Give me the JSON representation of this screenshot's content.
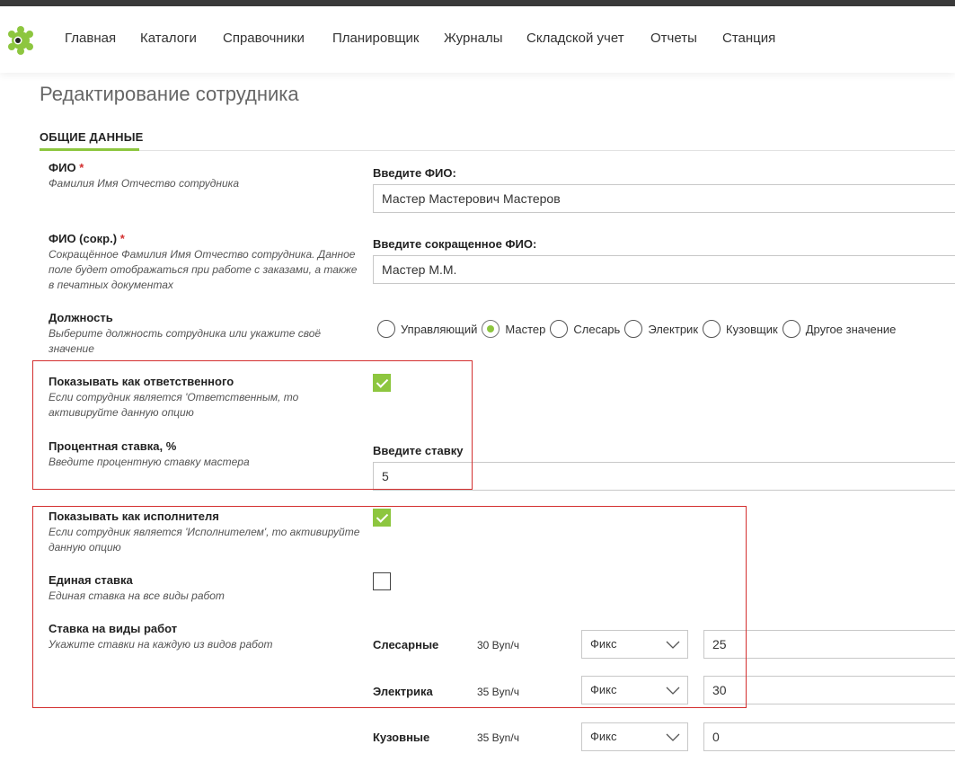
{
  "nav": {
    "items": [
      "Главная",
      "Каталоги",
      "Справочники",
      "Планировщик",
      "Журналы",
      "Складской учет",
      "Отчеты",
      "Станция"
    ]
  },
  "page": {
    "title": "Редактирование сотрудника",
    "section_tab": "ОБЩИЕ ДАННЫЕ"
  },
  "fio": {
    "label": "ФИО",
    "required_mark": "*",
    "hint": "Фамилия Имя Отчество сотрудника",
    "caption": "Введите ФИО:",
    "value": "Мастер Мастерович Мастеров"
  },
  "fio_short": {
    "label": "ФИО (сокр.)",
    "required_mark": "*",
    "hint": "Сокращённое Фамилия Имя Отчество сотрудника. Данное поле будет отображаться при работе с заказами, а также в печатных документах",
    "caption": "Введите сокращенное ФИО:",
    "value": "Мастер М.М."
  },
  "position": {
    "label": "Должность",
    "hint": "Выберите должность сотрудника или укажите своё значение",
    "options": [
      "Управляющий",
      "Мастер",
      "Слесарь",
      "Электрик",
      "Кузовщик",
      "Другое значение"
    ],
    "selected": "Мастер"
  },
  "responsible": {
    "label": "Показывать как ответственного",
    "hint": "Если сотрудник является 'Ответственным, то активируйте данную опцию",
    "checked": true
  },
  "percent_rate": {
    "label": "Процентная ставка, %",
    "hint": "Введите процентную ставку мастера",
    "caption": "Введите ставку",
    "value": "5"
  },
  "executor": {
    "label": "Показывать как исполнителя",
    "hint": "Если сотрудник является 'Исполнителем', то активируйте данную опцию",
    "checked": true
  },
  "single_rate": {
    "label": "Единая ставка",
    "hint": "Единая ставка на все виды работ",
    "checked": false
  },
  "work_rates": {
    "label": "Ставка на виды работ",
    "hint": "Укажите ставки на каждую из видов работ",
    "rows": [
      {
        "name": "Слесарные",
        "price": "30 Byn/ч",
        "type": "Фикс",
        "value": "25"
      },
      {
        "name": "Электрика",
        "price": "35 Byn/ч",
        "type": "Фикс",
        "value": "30"
      },
      {
        "name": "Кузовные",
        "price": "35 Byn/ч",
        "type": "Фикс",
        "value": "0"
      }
    ]
  },
  "colors": {
    "accent": "#8dc63f",
    "highlight_border": "#d32f2f",
    "required": "#d32f2f"
  },
  "icons": {
    "logo": "gear-logo-icon",
    "select_arrow": "chevron-down-icon"
  }
}
